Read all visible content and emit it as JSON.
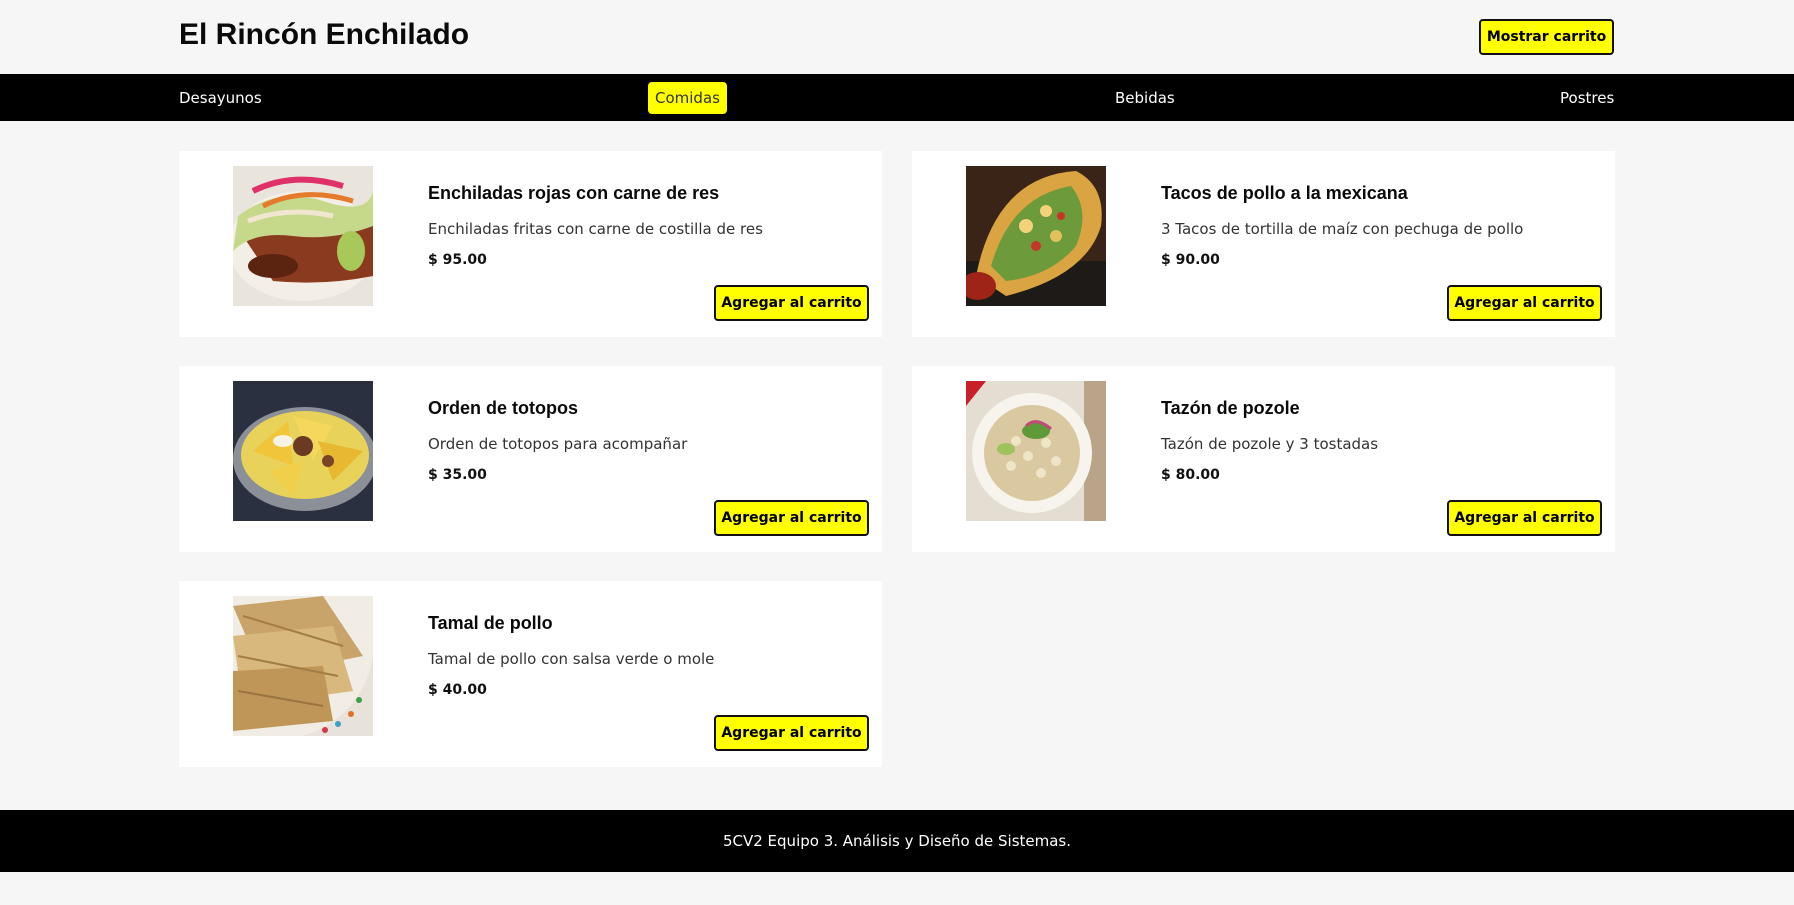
{
  "header": {
    "brand": "El Rincón Enchilado",
    "cart_button": "Mostrar carrito"
  },
  "nav": {
    "items": [
      {
        "label": "Desayunos"
      },
      {
        "label": "Comidas",
        "active": true
      },
      {
        "label": "Bebidas"
      },
      {
        "label": "Postres"
      }
    ]
  },
  "products": [
    {
      "title": "Enchiladas rojas con carne de res",
      "description": "Enchiladas fritas con carne de costilla de res",
      "price": "$ 95.00",
      "button": "Agregar al carrito",
      "image": "enchiladas-photo"
    },
    {
      "title": "Tacos de pollo a la mexicana",
      "description": "3 Tacos de tortilla de maíz con pechuga de pollo",
      "price": "$ 90.00",
      "button": "Agregar al carrito",
      "image": "tacos-photo"
    },
    {
      "title": "Orden de totopos",
      "description": "Orden de totopos para acompañar",
      "price": "$ 35.00",
      "button": "Agregar al carrito",
      "image": "totopos-photo"
    },
    {
      "title": "Tazón de pozole",
      "description": "Tazón de pozole y 3 tostadas",
      "price": "$ 80.00",
      "button": "Agregar al carrito",
      "image": "pozole-photo"
    },
    {
      "title": "Tamal de pollo",
      "description": "Tamal de pollo con salsa verde o mole",
      "price": "$ 40.00",
      "button": "Agregar al carrito",
      "image": "tamal-photo"
    }
  ],
  "footer": {
    "text": "5CV2 Equipo 3. Análisis y Diseño de Sistemas."
  },
  "colors": {
    "accent": "#ffff00",
    "nav_bg": "#000000",
    "page_bg": "#f6f6f6",
    "card_bg": "#ffffff"
  }
}
